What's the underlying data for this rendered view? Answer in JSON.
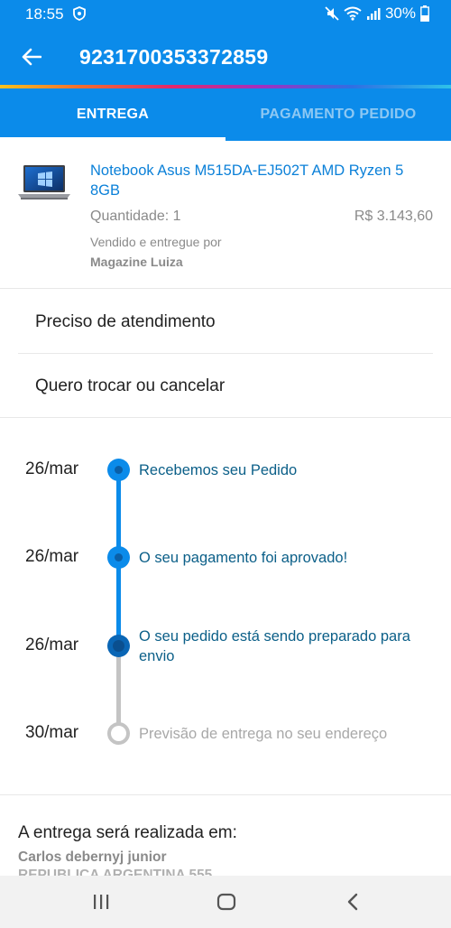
{
  "status_bar": {
    "time": "18:55",
    "battery": "30%",
    "icons": [
      "shield-icon",
      "mute-icon",
      "wifi-icon",
      "signal-icon",
      "battery-icon"
    ]
  },
  "app_bar": {
    "title": "9231700353372859",
    "back_icon": "arrow-left-icon"
  },
  "tabs": [
    {
      "label": "ENTREGA",
      "active": true
    },
    {
      "label": "PAGAMENTO PEDIDO",
      "active": false
    }
  ],
  "product": {
    "name": "Notebook Asus M515DA-EJ502T AMD Ryzen 5 8GB",
    "quantity": "Quantidade: 1",
    "price": "R$ 3.143,60",
    "sold_by_label": "Vendido e entregue por",
    "seller": "Magazine Luiza"
  },
  "actions": [
    {
      "label": "Preciso de atendimento"
    },
    {
      "label": "Quero trocar ou cancelar"
    }
  ],
  "timeline": [
    {
      "date": "26/mar",
      "text": "Recebemos seu Pedido",
      "state": "done"
    },
    {
      "date": "26/mar",
      "text": "O seu pagamento foi aprovado!",
      "state": "done"
    },
    {
      "date": "26/mar",
      "text": "O seu pedido está sendo preparado para envio",
      "state": "current"
    },
    {
      "date": "30/mar",
      "text": "Previsão de entrega no seu endereço",
      "state": "pending"
    }
  ],
  "delivery": {
    "title": "A entrega será realizada em:",
    "name": "Carlos debernyj junior",
    "address": "REPUBLICA ARGENTINA 555"
  },
  "colors": {
    "primary": "#0b8bea",
    "link_text": "#0b80d8",
    "timeline_text": "#0b5f88",
    "muted": "#8a8a8a"
  },
  "nav_bar": {
    "icons": [
      "recent-apps-icon",
      "home-icon",
      "back-icon"
    ]
  }
}
